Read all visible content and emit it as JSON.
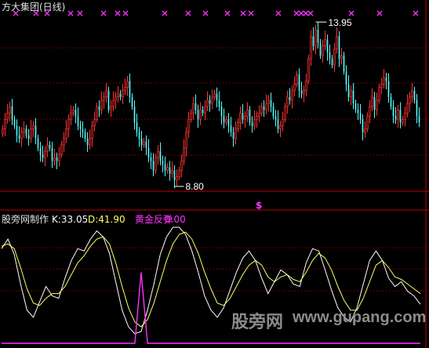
{
  "title": "方大集团(日线)",
  "price_high_label": "13.95",
  "price_low_label": "8.80",
  "signal_marker": "$",
  "indicator": {
    "name": "股旁网制作",
    "k_label": "K:33.05",
    "d_label": "D:41.90",
    "signal_name": "黄金反弹",
    "signal_value": "0.00"
  },
  "watermark": {
    "cn": "股旁网",
    "url": "www.gupang.com"
  },
  "colors": {
    "background": "#000000",
    "up_candle": "#ff3333",
    "down_candle": "#54ffff",
    "grid": "#c00000",
    "marker": "#ff33ff",
    "k_line": "#ffffff",
    "d_line": "#ffff66",
    "signal": "#ff33ff",
    "text": "#d0d0d0"
  },
  "chart_data": [
    {
      "type": "candlestick",
      "title": "方大集团(日线)",
      "ylim": [
        8.6,
        14.1
      ],
      "annotations": [
        {
          "text": "13.95",
          "kind": "high"
        },
        {
          "text": "8.80",
          "kind": "low"
        }
      ],
      "close": [
        10.6,
        10.9,
        11.1,
        11.3,
        10.9,
        10.7,
        10.4,
        10.3,
        10.5,
        10.6,
        10.4,
        10.3,
        10.6,
        10.7,
        10.3,
        10.0,
        9.8,
        9.7,
        9.9,
        10.1,
        10.0,
        9.6,
        9.7,
        9.6,
        9.8,
        10.1,
        10.3,
        10.6,
        10.9,
        11.1,
        11.2,
        11.0,
        10.7,
        10.6,
        10.5,
        10.3,
        10.1,
        10.3,
        10.7,
        10.9,
        11.3,
        11.2,
        11.5,
        11.6,
        11.8,
        11.2,
        11.3,
        11.5,
        11.6,
        11.7,
        11.6,
        11.8,
        11.9,
        12.1,
        11.6,
        11.3,
        10.8,
        10.5,
        10.3,
        10.1,
        10.2,
        10.0,
        9.7,
        9.6,
        9.3,
        9.7,
        9.9,
        9.6,
        9.5,
        9.3,
        9.4,
        9.2,
        9.3,
        9.0,
        9.1,
        9.3,
        9.6,
        10.0,
        10.5,
        10.9,
        11.1,
        11.4,
        11.2,
        10.9,
        11.2,
        11.1,
        11.3,
        11.5,
        11.4,
        11.6,
        11.7,
        11.5,
        11.3,
        11.0,
        10.8,
        10.9,
        10.7,
        10.5,
        10.3,
        10.6,
        10.8,
        11.1,
        10.9,
        11.0,
        11.2,
        10.8,
        10.7,
        10.9,
        11.0,
        11.1,
        11.3,
        11.2,
        11.4,
        11.5,
        11.3,
        11.0,
        10.9,
        10.6,
        10.7,
        10.9,
        11.3,
        11.6,
        11.5,
        11.8,
        12.0,
        12.3,
        11.8,
        11.7,
        11.8,
        12.1,
        12.8,
        13.5,
        13.2,
        13.7,
        13.3,
        12.9,
        13.2,
        13.4,
        13.0,
        12.8,
        12.6,
        13.1,
        13.5,
        12.8,
        12.9,
        12.4,
        12.0,
        11.6,
        11.8,
        11.4,
        11.2,
        11.1,
        10.9,
        10.5,
        10.6,
        11.0,
        11.3,
        11.6,
        11.2,
        11.5,
        11.9,
        12.0,
        12.2,
        12.1,
        11.6,
        11.3,
        11.0,
        10.9,
        11.2,
        10.8,
        10.9,
        11.1,
        11.4,
        11.6,
        11.8,
        11.5,
        11.0,
        10.8
      ]
    },
    {
      "type": "line",
      "title": "股旁网制作",
      "ylim": [
        0,
        100
      ],
      "series": [
        {
          "name": "K",
          "values": [
            80,
            88,
            75,
            50,
            28,
            22,
            35,
            48,
            40,
            38,
            55,
            70,
            80,
            78,
            88,
            95,
            90,
            76,
            52,
            28,
            14,
            8,
            10,
            28,
            50,
            75,
            90,
            98,
            98,
            92,
            78,
            60,
            40,
            28,
            22,
            30,
            45,
            60,
            72,
            78,
            70,
            55,
            42,
            52,
            62,
            58,
            50,
            48,
            68,
            80,
            78,
            62,
            45,
            30,
            22,
            18,
            30,
            50,
            70,
            78,
            70,
            55,
            48,
            52,
            44,
            40,
            33
          ]
        },
        {
          "name": "D",
          "values": [
            82,
            84,
            80,
            64,
            46,
            34,
            32,
            38,
            42,
            42,
            48,
            58,
            68,
            74,
            82,
            88,
            90,
            84,
            68,
            48,
            30,
            18,
            14,
            20,
            34,
            52,
            70,
            84,
            92,
            94,
            88,
            76,
            60,
            46,
            34,
            32,
            38,
            48,
            58,
            66,
            70,
            66,
            56,
            52,
            56,
            58,
            54,
            52,
            60,
            70,
            76,
            72,
            62,
            48,
            36,
            28,
            28,
            38,
            52,
            66,
            70,
            64,
            56,
            54,
            50,
            46,
            42
          ]
        },
        {
          "name": "黄金反弹",
          "values": [
            0,
            0,
            0,
            0,
            0,
            0,
            0,
            0,
            0,
            0,
            0,
            0,
            0,
            0,
            0,
            0,
            0,
            0,
            0,
            0,
            0,
            0,
            60,
            0,
            0,
            0,
            0,
            0,
            0,
            0,
            0,
            0,
            0,
            0,
            0,
            0,
            0,
            0,
            0,
            0,
            0,
            0,
            0,
            0,
            0,
            0,
            0,
            0,
            0,
            0,
            0,
            0,
            0,
            0,
            0,
            0,
            0,
            0,
            0,
            0,
            0,
            0,
            0,
            0,
            0,
            0,
            0
          ]
        }
      ]
    }
  ]
}
